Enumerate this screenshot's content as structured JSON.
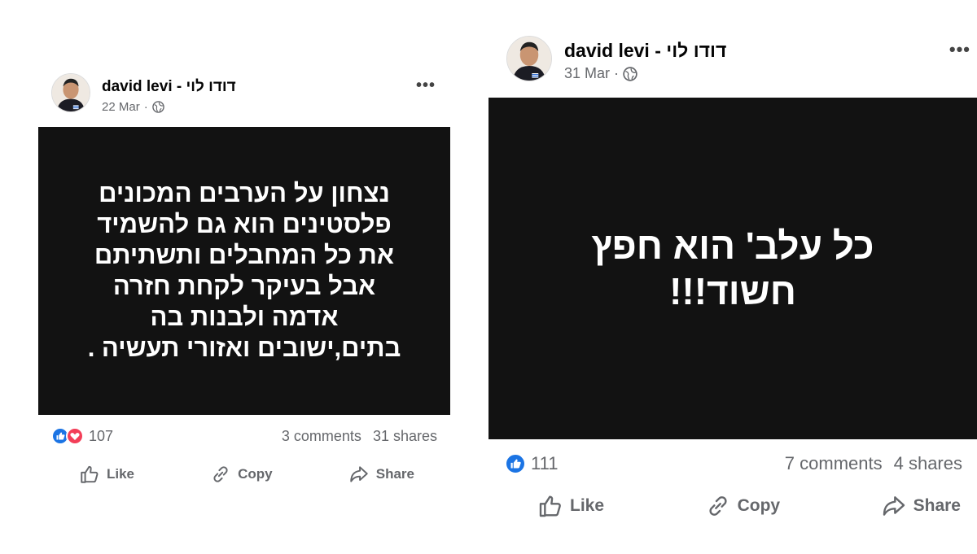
{
  "posts": [
    {
      "author": "david levi - דודו לוי",
      "date": "22 Mar",
      "image_text": "נצחון על הערבים המכונים\nפלסטינים הוא גם להשמיד\nאת כל המחבלים ותשתיתם\nאבל בעיקר לקחת חזרה\nאדמה ולבנות בה\nבתים,ישובים ואזורי תעשיה .",
      "reaction_count": "107",
      "comments": "3 comments",
      "shares": "31 shares",
      "actions": {
        "like": "Like",
        "copy": "Copy",
        "share": "Share"
      },
      "reactions": [
        "like-react-icon",
        "love-react-icon"
      ]
    },
    {
      "author": "david levi - דודו לוי",
      "date": "31 Mar",
      "image_text": "כל  עלב' הוא חפץ\nחשוד!!!",
      "reaction_count": "111",
      "comments": "7 comments",
      "shares": "4 shares",
      "actions": {
        "like": "Like",
        "copy": "Copy",
        "share": "Share"
      },
      "reactions": [
        "like-react-icon"
      ]
    }
  ],
  "colors": {
    "image_bg": "#121212",
    "like_blue": "#1b74e4",
    "love_red": "#f33e58",
    "meta_gray": "#65676b"
  }
}
